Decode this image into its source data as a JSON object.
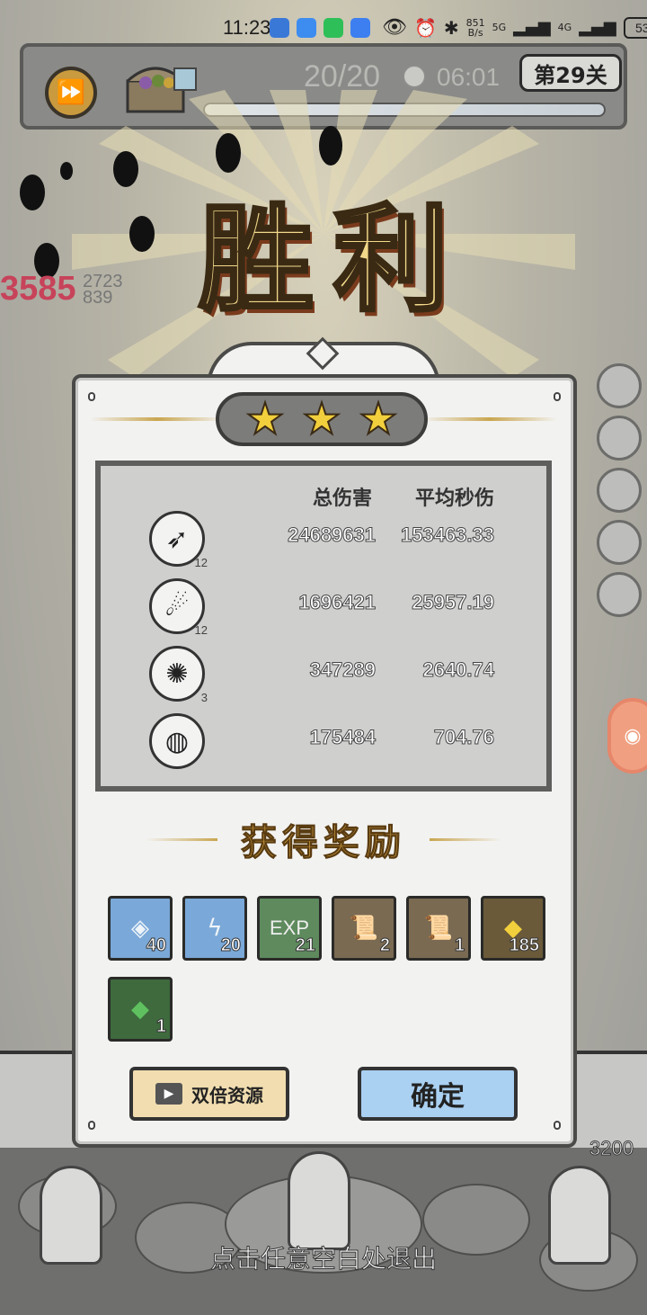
{
  "status_bar": {
    "time": "11:23",
    "net_speed": "851\nB/s",
    "net_speed_top": "851",
    "net_speed_bottom": "B/s",
    "sig1": "5G",
    "sig2": "4G",
    "battery": "53"
  },
  "top_bar": {
    "wave": "20/20",
    "timer": "06:01",
    "level": "第29关",
    "boss_hp_percent": 100
  },
  "title": "胜利",
  "title_chars": [
    "胜",
    "利"
  ],
  "stars_earned": 3,
  "stars_total": 3,
  "left_damage": "3585",
  "left_damage_small": [
    "2723",
    "839"
  ],
  "stats": {
    "header_total": "总伤害",
    "header_dps": "平均秒伤",
    "rows": [
      {
        "icon": "triple-shot-skill-icon",
        "level": "12",
        "total": "24689631",
        "dps": "153463.33"
      },
      {
        "icon": "arrow-streak-skill-icon",
        "level": "12",
        "total": "1696421",
        "dps": "25957.19"
      },
      {
        "icon": "crystal-burst-skill-icon",
        "level": "3",
        "total": "347289",
        "dps": "2640.74"
      },
      {
        "icon": "fire-orb-skill-icon",
        "level": "",
        "total": "175484",
        "dps": "704.76"
      }
    ]
  },
  "reward_title": "获得奖励",
  "rewards": [
    {
      "icon": "crystal-shard-icon",
      "count": "40",
      "bg": "#7aa8d8"
    },
    {
      "icon": "lightning-shard-icon",
      "count": "20",
      "bg": "#7aa8d8"
    },
    {
      "icon": "exp-icon",
      "label": "EXP",
      "count": "21",
      "bg": "#5e8a5e"
    },
    {
      "icon": "scroll-hat-icon",
      "count": "2",
      "bg": "#7a6a52"
    },
    {
      "icon": "scroll-boot-icon",
      "count": "1",
      "bg": "#7a6a52"
    },
    {
      "icon": "gold-coin-icon",
      "count": "185",
      "bg": "#6a5a3a"
    },
    {
      "icon": "green-gem-icon",
      "count": "1",
      "bg": "#3e6a3e"
    }
  ],
  "buttons": {
    "double": "双倍资源",
    "confirm": "确定"
  },
  "ground_hp": "3200",
  "exit_hint": "点击任意空白处退出",
  "colors": {
    "gold": "#f2d98a",
    "star": "#f2cf3c",
    "confirm_bg": "#aad0f2",
    "double_bg": "#f1ddb0",
    "damage_red": "#c7435a"
  }
}
